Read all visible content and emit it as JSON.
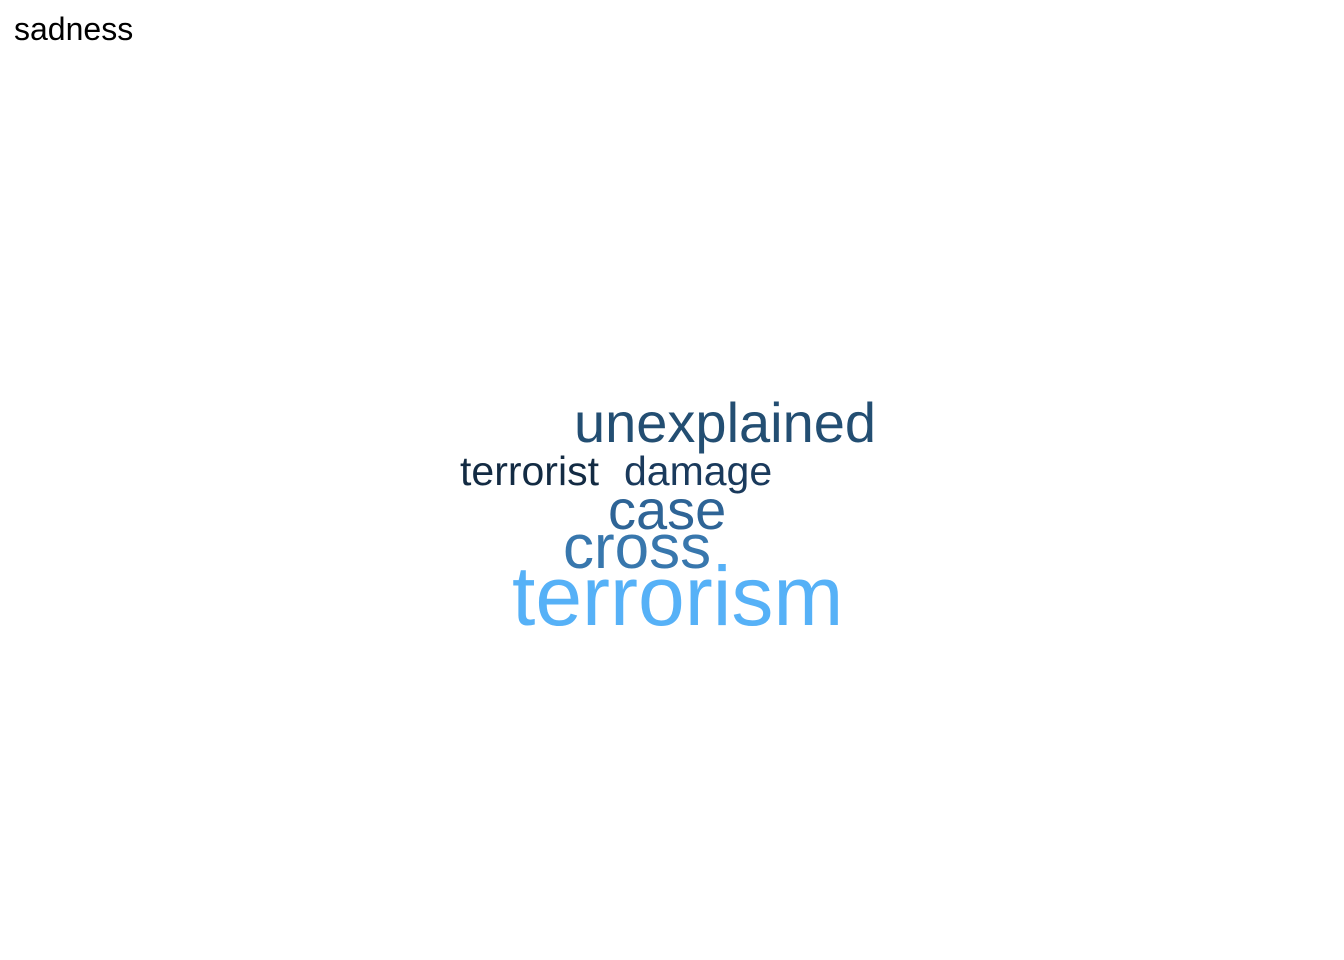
{
  "title": "sadness",
  "cloud": {
    "words": [
      {
        "text": "unexplained",
        "color": "#234e72"
      },
      {
        "text": "terrorist",
        "color": "#132b43"
      },
      {
        "text": "damage",
        "color": "#1a3a5c"
      },
      {
        "text": "case",
        "color": "#2e6496"
      },
      {
        "text": "cross",
        "color": "#3877ad"
      },
      {
        "text": "terrorism",
        "color": "#56b1f7"
      }
    ]
  }
}
